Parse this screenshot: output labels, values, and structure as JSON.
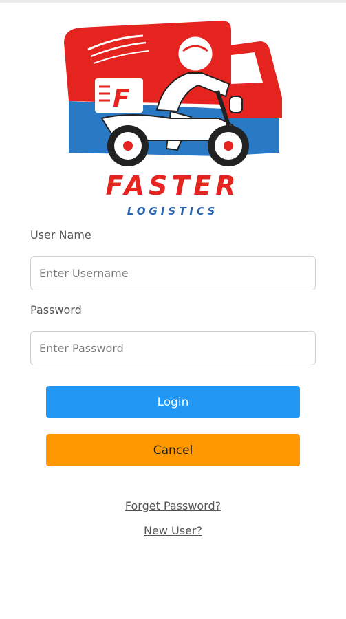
{
  "logo": {
    "title": "FASTER",
    "subtitle": "LOGISTICS",
    "badge_letter": "F",
    "colors": {
      "red": "#e5231f",
      "blue": "#2a79c4",
      "dark": "#222222"
    }
  },
  "form": {
    "username_label": "User Name",
    "username_placeholder": "Enter Username",
    "password_label": "Password",
    "password_placeholder": "Enter Password"
  },
  "buttons": {
    "login_label": "Login",
    "cancel_label": "Cancel"
  },
  "links": {
    "forget_password": "Forget Password?",
    "new_user": "New User?"
  },
  "colors": {
    "login_button": "#2196f3",
    "cancel_button": "#ff9800"
  }
}
